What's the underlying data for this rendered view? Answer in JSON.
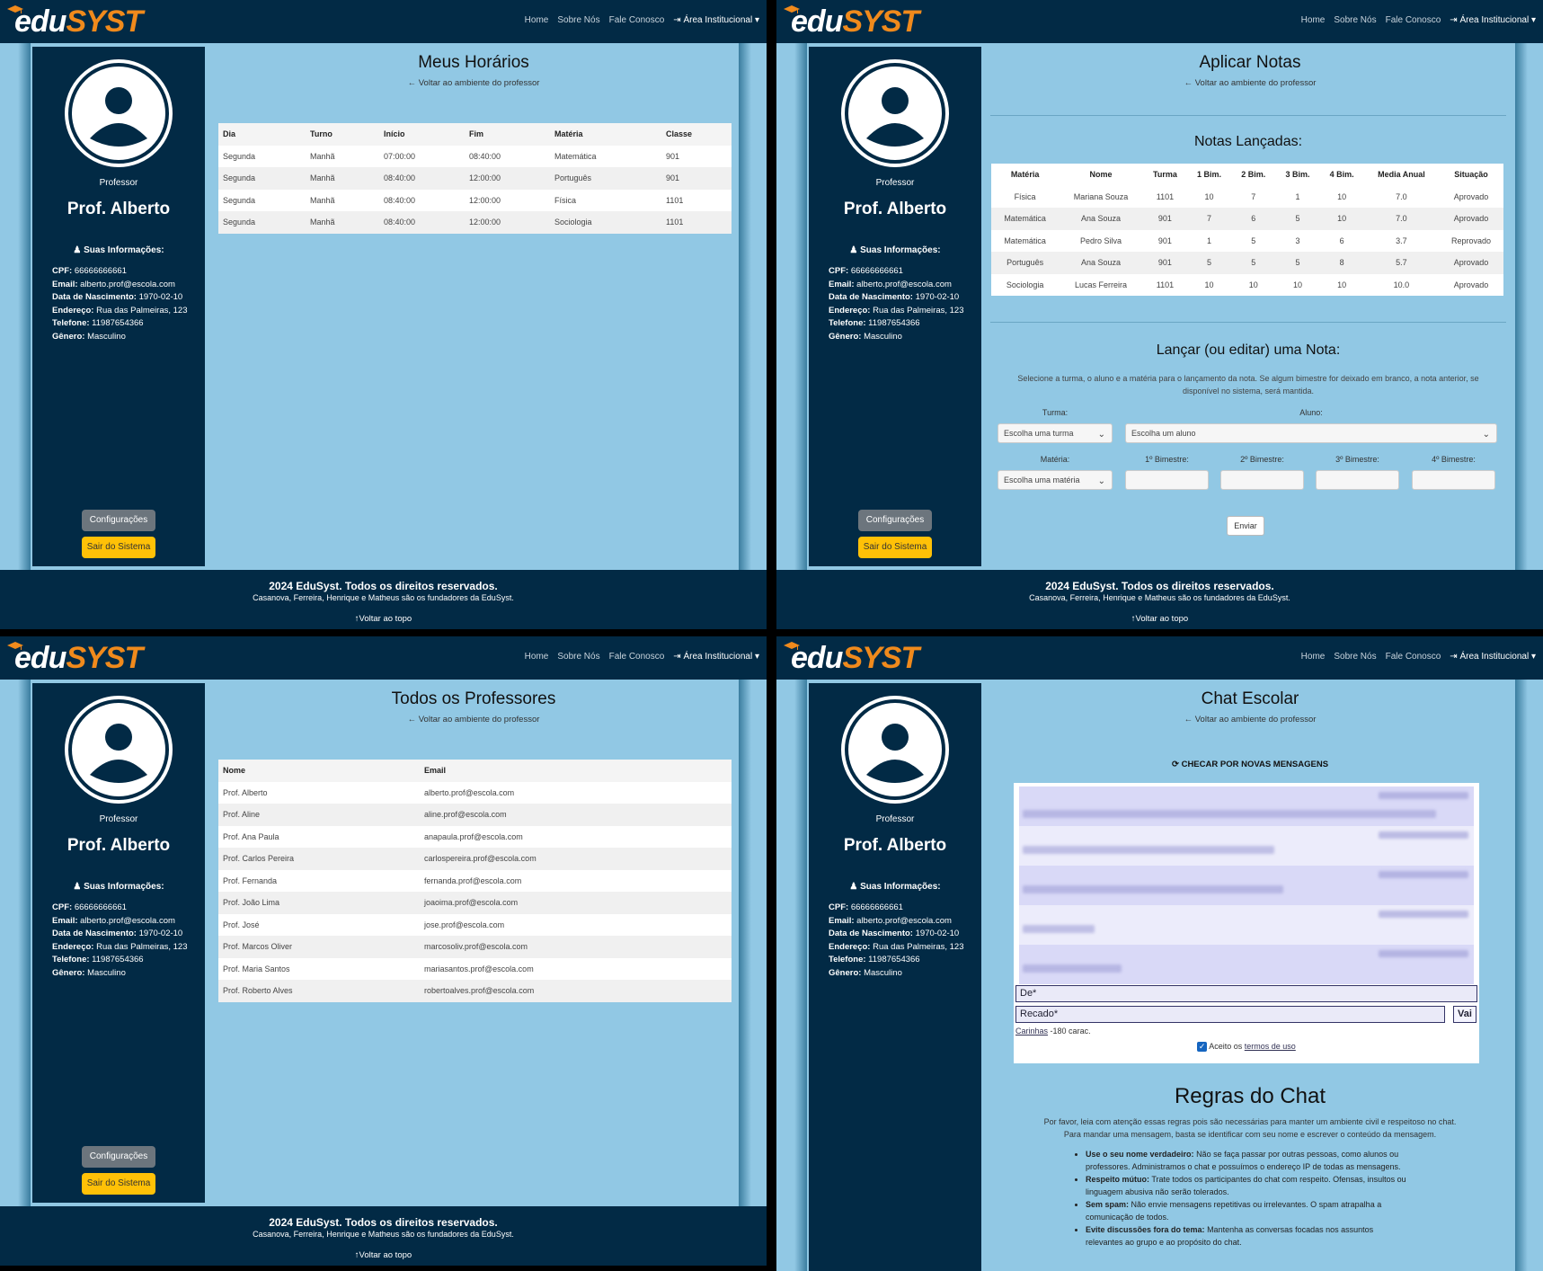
{
  "nav": {
    "logo_a": "edu",
    "logo_b": "SYST",
    "home": "Home",
    "about": "Sobre Nós",
    "contact": "Fale Conosco",
    "area": "Área Institucional"
  },
  "profile": {
    "role": "Professor",
    "name": "Prof. Alberto",
    "info_header": "Suas Informações:",
    "cpf_label": "CPF:",
    "cpf": "66666666661",
    "email_label": "Email:",
    "email": "alberto.prof@escola.com",
    "birth_label": "Data de Nascimento:",
    "birth": "1970-02-10",
    "address_label": "Endereço:",
    "address": "Rua das Palmeiras, 123",
    "phone_label": "Telefone:",
    "phone": "11987654366",
    "gender_label": "Gênero:",
    "gender": "Masculino",
    "config_button": "Configurações",
    "logout_button": "Sair do Sistema"
  },
  "back_link": "Voltar ao ambiente do professor",
  "footer": {
    "line1": "2024 EduSyst. Todos os direitos reservados.",
    "line2": "Casanova, Ferreira, Henrique e Matheus são os fundadores da EduSyst.",
    "top": "Voltar ao topo"
  },
  "schedule": {
    "title": "Meus Horários",
    "headers": [
      "Dia",
      "Turno",
      "Início",
      "Fim",
      "Matéria",
      "Classe"
    ],
    "rows": [
      [
        "Segunda",
        "Manhã",
        "07:00:00",
        "08:40:00",
        "Matemática",
        "901"
      ],
      [
        "Segunda",
        "Manhã",
        "08:40:00",
        "12:00:00",
        "Português",
        "901"
      ],
      [
        "Segunda",
        "Manhã",
        "08:40:00",
        "12:00:00",
        "Física",
        "1101"
      ],
      [
        "Segunda",
        "Manhã",
        "08:40:00",
        "12:00:00",
        "Sociologia",
        "1101"
      ]
    ]
  },
  "grades": {
    "title": "Aplicar Notas",
    "launched_title": "Notas Lançadas:",
    "headers": [
      "Matéria",
      "Nome",
      "Turma",
      "1 Bim.",
      "2 Bim.",
      "3 Bim.",
      "4 Bim.",
      "Media Anual",
      "Situação"
    ],
    "rows": [
      [
        "Física",
        "Mariana Souza",
        "1101",
        "10",
        "7",
        "1",
        "10",
        "7.0",
        "Aprovado"
      ],
      [
        "Matemática",
        "Ana Souza",
        "901",
        "7",
        "6",
        "5",
        "10",
        "7.0",
        "Aprovado"
      ],
      [
        "Matemática",
        "Pedro Silva",
        "901",
        "1",
        "5",
        "3",
        "6",
        "3.7",
        "Reprovado"
      ],
      [
        "Português",
        "Ana Souza",
        "901",
        "5",
        "5",
        "5",
        "8",
        "5.7",
        "Aprovado"
      ],
      [
        "Sociologia",
        "Lucas Ferreira",
        "1101",
        "10",
        "10",
        "10",
        "10",
        "10.0",
        "Aprovado"
      ]
    ],
    "form_title": "Lançar (ou editar) uma Nota:",
    "form_desc1": "Selecione a turma, o aluno e a matéria para o lançamento da nota. Se algum bimestre for deixado em branco, a nota anterior, se",
    "form_desc2": "disponível no sistema, será mantida.",
    "turma_label": "Turma:",
    "turma_value": "Escolha uma turma",
    "aluno_label": "Aluno:",
    "aluno_value": "Escolha um aluno",
    "materia_label": "Matéria:",
    "materia_value": "Escolha uma matéria",
    "b1_label": "1º Bimestre:",
    "b2_label": "2º Bimestre:",
    "b3_label": "3º Bimestre:",
    "b4_label": "4º Bimestre:",
    "send_button": "Enviar"
  },
  "teachers": {
    "title": "Todos os Professores",
    "headers": [
      "Nome",
      "Email"
    ],
    "rows": [
      [
        "Prof. Alberto",
        "alberto.prof@escola.com"
      ],
      [
        "Prof. Aline",
        "aline.prof@escola.com"
      ],
      [
        "Prof. Ana Paula",
        "anapaula.prof@escola.com"
      ],
      [
        "Prof. Carlos Pereira",
        "carlospereira.prof@escola.com"
      ],
      [
        "Prof. Fernanda",
        "fernanda.prof@escola.com"
      ],
      [
        "Prof. João Lima",
        "joaoima.prof@escola.com"
      ],
      [
        "Prof. José",
        "jose.prof@escola.com"
      ],
      [
        "Prof. Marcos Oliver",
        "marcosoliv.prof@escola.com"
      ],
      [
        "Prof. Maria Santos",
        "mariasantos.prof@escola.com"
      ],
      [
        "Prof. Roberto Alves",
        "robertoalves.prof@escola.com"
      ]
    ]
  },
  "chat": {
    "title": "Chat Escolar",
    "refresh": "CHECAR POR NOVAS MENSAGENS",
    "from_placeholder": "De*",
    "msg_placeholder": "Recado*",
    "go_button": "Vai",
    "smileys_link": "Carinhas",
    "char_limit": "-180 carac.",
    "accept_text": "Aceito os",
    "terms_link": "termos de uso",
    "rules_title": "Regras do Chat",
    "rules_intro1": "Por favor, leia com atenção essas regras pois são necessárias para manter um ambiente civil e respeitoso no chat.",
    "rules_intro2": "Para mandar uma mensagem, basta se identificar com seu nome e escrever o conteúdo da mensagem.",
    "rules": [
      {
        "bold": "Use o seu nome verdadeiro:",
        "text": "Não se faça passar por outras pessoas, como alunos ou professores. Administramos o chat e possuímos o endereço IP de todas as mensagens."
      },
      {
        "bold": "Respeito mútuo:",
        "text": "Trate todos os participantes do chat com respeito. Ofensas, insultos ou linguagem abusiva não serão tolerados."
      },
      {
        "bold": "Sem spam:",
        "text": "Não envie mensagens repetitivas ou irrelevantes. O spam atrapalha a comunicação de todos."
      },
      {
        "bold": "Evite discussões fora do tema:",
        "text": "Mantenha as conversas focadas nos assuntos relevantes ao grupo e ao propósito do chat."
      }
    ]
  },
  "colors": {
    "navy": "#022a45",
    "light_blue": "#91c8e4",
    "accent_orange": "#f08a1c",
    "warning": "#ffc107",
    "secondary": "#6c757d"
  }
}
